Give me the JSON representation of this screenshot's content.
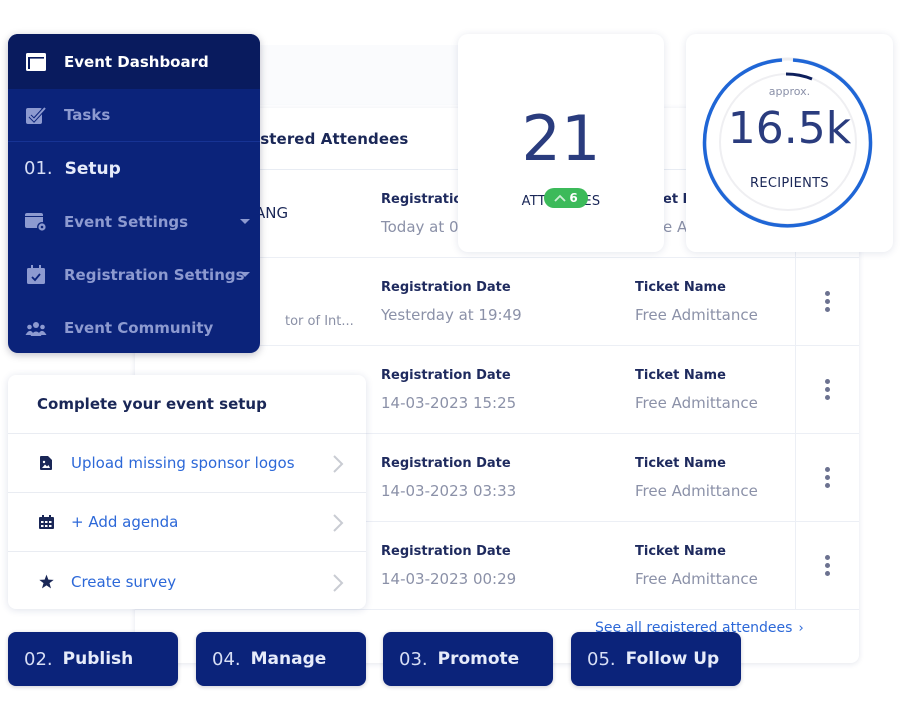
{
  "sidebar": {
    "items": [
      {
        "label": "Event Dashboard",
        "icon": "dashboard-icon",
        "active": true
      },
      {
        "label": "Tasks",
        "icon": "tasks-check-icon"
      },
      {
        "step": "01.",
        "label": "Setup"
      },
      {
        "label": "Event Settings",
        "icon": "event-settings-icon",
        "has_dropdown": true
      },
      {
        "label": "Registration Settings",
        "icon": "registration-calendar-icon",
        "has_dropdown": true
      },
      {
        "label": "Event Community",
        "icon": "community-icon"
      }
    ]
  },
  "attendees_panel": {
    "title_visible": "istered Attendees",
    "rows": [
      {
        "name": "ANG",
        "role": "",
        "date_label": "Registration",
        "date_value": "Today at 0",
        "ticket_label": "et N",
        "ticket_value": "e Ac"
      },
      {
        "name": "",
        "role": "tor of Int...",
        "date_label": "Registration Date",
        "date_value": "Yesterday at 19:49",
        "ticket_label": "Ticket Name",
        "ticket_value": "Free Admittance"
      },
      {
        "name": "",
        "role": "",
        "date_label": "Registration Date",
        "date_value": "14-03-2023 15:25",
        "ticket_label": "Ticket Name",
        "ticket_value": "Free Admittance"
      },
      {
        "name": "",
        "role": "",
        "date_label": "Registration Date",
        "date_value": "14-03-2023 03:33",
        "ticket_label": "Ticket Name",
        "ticket_value": "Free Admittance"
      },
      {
        "name": "",
        "role": "",
        "date_label": "Registration Date",
        "date_value": "14-03-2023 00:29",
        "ticket_label": "Ticket Name",
        "ticket_value": "Free Admittance"
      }
    ],
    "see_all_label": "See all registered attendees",
    "see_all_chevron": "›"
  },
  "stats": {
    "attendees": {
      "value": "21",
      "label": "ATTENDEES",
      "delta": "6",
      "delta_arrow": "^",
      "delta_color": "#3cba5a"
    },
    "recipients": {
      "approx_label": "approx.",
      "value": "16.5k",
      "label": "RECIPIENTS",
      "ring_color": "#1f66d6"
    }
  },
  "setup_checklist": {
    "title": "Complete your event setup",
    "items": [
      {
        "label": "Upload missing sponsor logos",
        "icon": "image-file-icon"
      },
      {
        "label": "+ Add agenda",
        "icon": "calendar-grid-icon"
      },
      {
        "label": "Create survey",
        "icon": "star-icon"
      }
    ]
  },
  "steps": [
    {
      "num": "02.",
      "label": "Publish"
    },
    {
      "num": "04.",
      "label": "Manage"
    },
    {
      "num": "03.",
      "label": "Promote"
    },
    {
      "num": "05.",
      "label": "Follow Up"
    }
  ],
  "colors": {
    "navy": "#0b237a",
    "navy_active": "#091b5e",
    "link_blue": "#2c68d8",
    "success_green": "#3cba5a"
  }
}
